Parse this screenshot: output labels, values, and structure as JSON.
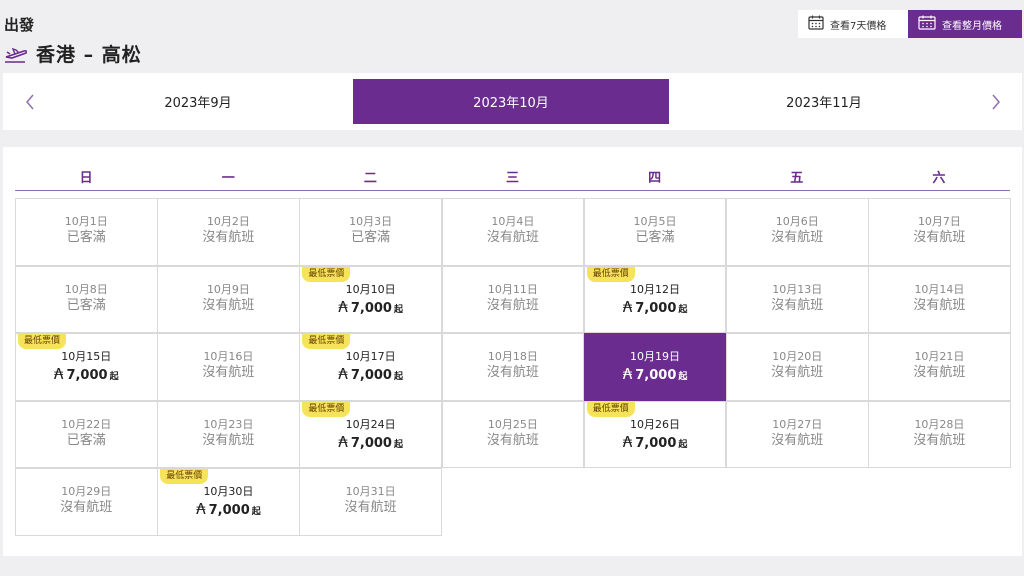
{
  "header": {
    "depart_label": "出發",
    "route": "香港 – 高松"
  },
  "view_toggle": {
    "week_label": "查看7天價格",
    "month_label": "查看整月價格"
  },
  "months": {
    "prev": "2023年9月",
    "current": "2023年10月",
    "next": "2023年11月"
  },
  "weekdays": [
    "日",
    "一",
    "二",
    "三",
    "四",
    "五",
    "六"
  ],
  "calendar": {
    "badge_label": "最低票價",
    "currency_symbol": "₳",
    "from_suffix": "起",
    "days": [
      {
        "date": "10月1日",
        "status": "已客滿"
      },
      {
        "date": "10月2日",
        "status": "沒有航班"
      },
      {
        "date": "10月3日",
        "status": "已客滿"
      },
      {
        "date": "10月4日",
        "status": "沒有航班"
      },
      {
        "date": "10月5日",
        "status": "已客滿"
      },
      {
        "date": "10月6日",
        "status": "沒有航班"
      },
      {
        "date": "10月7日",
        "status": "沒有航班"
      },
      {
        "date": "10月8日",
        "status": "已客滿"
      },
      {
        "date": "10月9日",
        "status": "沒有航班"
      },
      {
        "date": "10月10日",
        "price": "7,000",
        "badge": true
      },
      {
        "date": "10月11日",
        "status": "沒有航班"
      },
      {
        "date": "10月12日",
        "price": "7,000",
        "badge": true
      },
      {
        "date": "10月13日",
        "status": "沒有航班"
      },
      {
        "date": "10月14日",
        "status": "沒有航班"
      },
      {
        "date": "10月15日",
        "price": "7,000",
        "badge": true
      },
      {
        "date": "10月16日",
        "status": "沒有航班"
      },
      {
        "date": "10月17日",
        "price": "7,000",
        "badge": true
      },
      {
        "date": "10月18日",
        "status": "沒有航班"
      },
      {
        "date": "10月19日",
        "price": "7,000",
        "selected": true
      },
      {
        "date": "10月20日",
        "status": "沒有航班"
      },
      {
        "date": "10月21日",
        "status": "沒有航班"
      },
      {
        "date": "10月22日",
        "status": "已客滿"
      },
      {
        "date": "10月23日",
        "status": "沒有航班"
      },
      {
        "date": "10月24日",
        "price": "7,000",
        "badge": true
      },
      {
        "date": "10月25日",
        "status": "沒有航班"
      },
      {
        "date": "10月26日",
        "price": "7,000",
        "badge": true
      },
      {
        "date": "10月27日",
        "status": "沒有航班"
      },
      {
        "date": "10月28日",
        "status": "沒有航班"
      },
      {
        "date": "10月29日",
        "status": "沒有航班"
      },
      {
        "date": "10月30日",
        "price": "7,000",
        "badge": true
      },
      {
        "date": "10月31日",
        "status": "沒有航班"
      }
    ]
  },
  "colors": {
    "brand_purple": "#6a2c8e",
    "badge_yellow": "#f5e45a"
  }
}
